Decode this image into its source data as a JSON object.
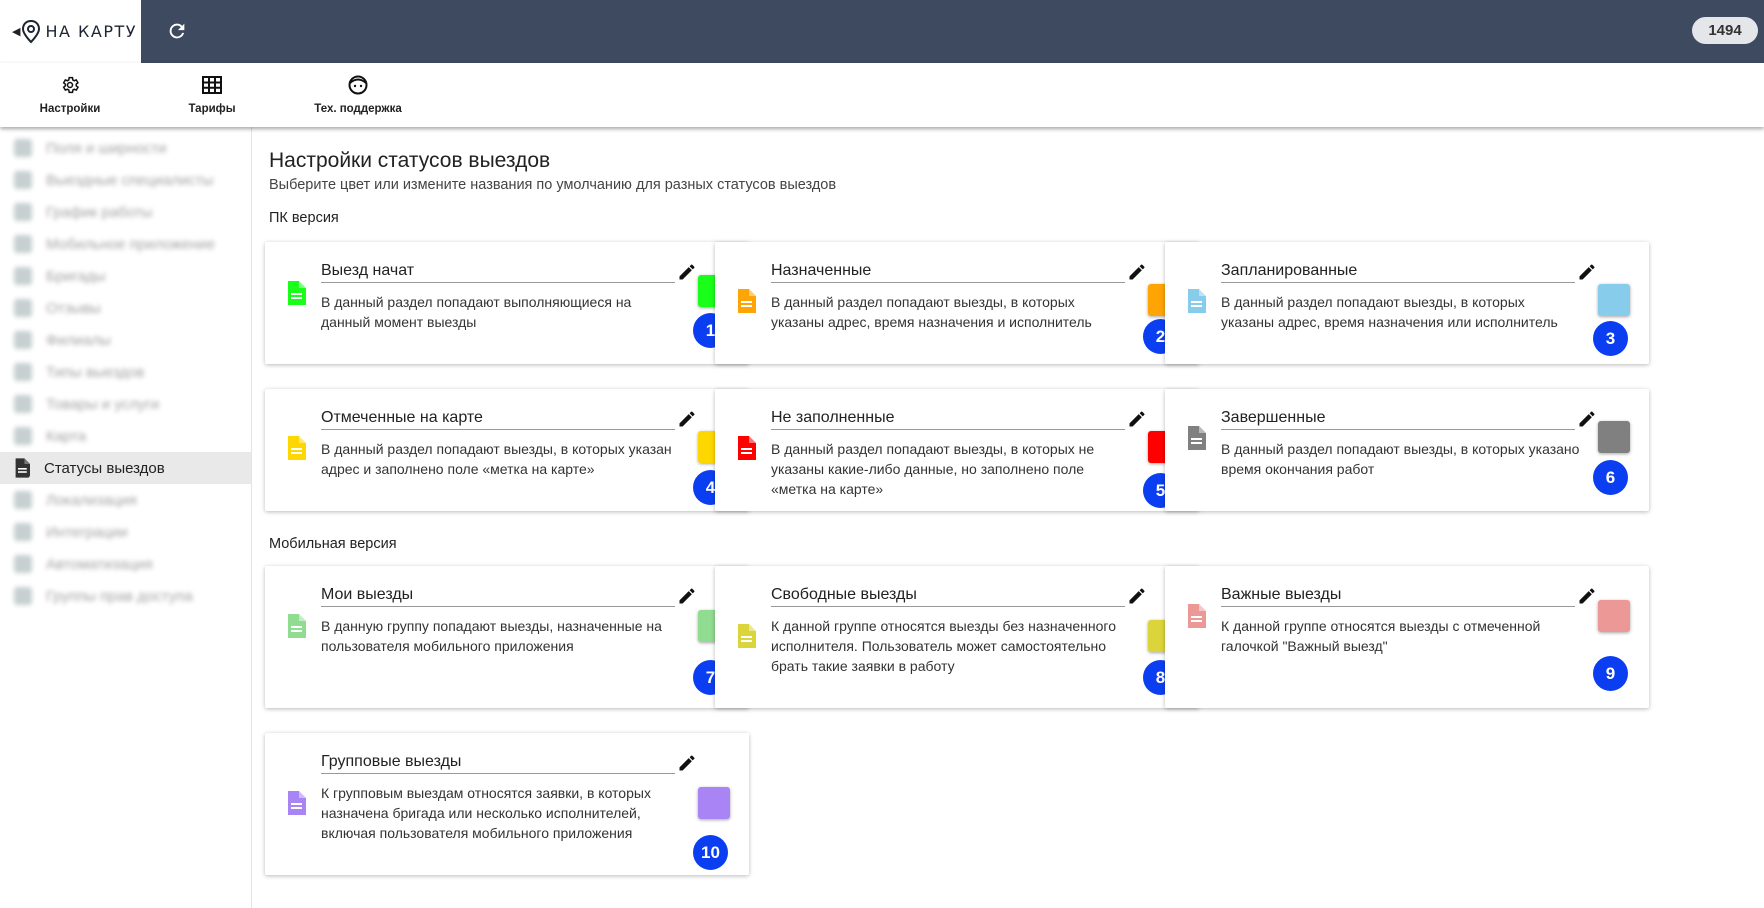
{
  "header": {
    "logo_text": "НА КАРТУ",
    "counter": "1494",
    "bg_color": "#3e4a5f"
  },
  "toolbar": {
    "items": [
      {
        "label": "Настройки",
        "icon": "gear-icon"
      },
      {
        "label": "Тарифы",
        "icon": "table-icon"
      },
      {
        "label": "Тех. поддержка",
        "icon": "support-icon"
      }
    ]
  },
  "sidebar": {
    "items": [
      {
        "label": "Поля и ширности",
        "blurred": true
      },
      {
        "label": "Выездные специалисты",
        "blurred": true
      },
      {
        "label": "График работы",
        "blurred": true
      },
      {
        "label": "Мобильное приложение",
        "blurred": true
      },
      {
        "label": "Бригады",
        "blurred": true
      },
      {
        "label": "Отзывы",
        "blurred": true
      },
      {
        "label": "Филиалы",
        "blurred": true
      },
      {
        "label": "Типы выездов",
        "blurred": true
      },
      {
        "label": "Товары и услуги",
        "blurred": true
      },
      {
        "label": "Карта",
        "blurred": true
      },
      {
        "label": "Статусы выездов",
        "blurred": false,
        "active": true
      },
      {
        "label": "Локализация",
        "blurred": true
      },
      {
        "label": "Интеграции",
        "blurred": true
      },
      {
        "label": "Автоматизация",
        "blurred": true
      },
      {
        "label": "Группы прав доступа",
        "blurred": true
      }
    ]
  },
  "main": {
    "title": "Настройки статусов выездов",
    "subtitle": "Выберите цвет или измените названия по умолчанию для разных статусов выездов",
    "section_pc": "ПК версия",
    "section_mobile": "Мобильная версия",
    "cards": [
      {
        "title": "Выезд начат",
        "desc": "В данный раздел попадают выполняющиеся на данный момент выезды",
        "color": "#19ff19",
        "number": "1"
      },
      {
        "title": "Назначенные",
        "desc": "В данный раздел попадают выезды, в которых указаны адрес, время назначения и исполнитель",
        "color": "#ffa405",
        "number": "2"
      },
      {
        "title": "Запланированные",
        "desc": "В данный раздел попадают выезды, в которых указаны адрес, время назначения или исполнитель",
        "color": "#87cdeb",
        "number": "3"
      },
      {
        "title": "Отмеченные на карте",
        "desc": "В данный раздел попадают выезды, в которых указан адрес и заполнено поле «метка на карте»",
        "color": "#ffd700",
        "number": "4"
      },
      {
        "title": "Не заполненные",
        "desc": "В данный раздел попадают выезды, в которых не указаны какие-либо данные, но заполнено поле «метка на карте»",
        "color": "#ff0000",
        "number": "5"
      },
      {
        "title": "Завершенные",
        "desc": "В данный раздел попадают выезды, в которых указано время окончания работ",
        "color": "#808080",
        "number": "6"
      },
      {
        "title": "Мои выезды",
        "desc": "В данную группу попадают выезды, назначенные на пользователя мобильного приложения",
        "color": "#90dc90",
        "number": "7"
      },
      {
        "title": "Свободные выезды",
        "desc": "К данной группе относятся выезды без назначенного исполнителя. Пользователь может самостоятельно брать такие заявки в работу",
        "color": "#dbd53b",
        "number": "8"
      },
      {
        "title": "Важные выезды",
        "desc": "К данной группе относятся выезды с отмеченной галочкой \"Важный выезд\"",
        "color": "#ec9897",
        "number": "9"
      },
      {
        "title": "Групповые выезды",
        "desc": "К групповым выездам относятся заявки, в которых назначена бригада или несколько исполнителей, включая пользователя мобильного приложения",
        "color": "#a884f5",
        "number": "10"
      }
    ]
  }
}
